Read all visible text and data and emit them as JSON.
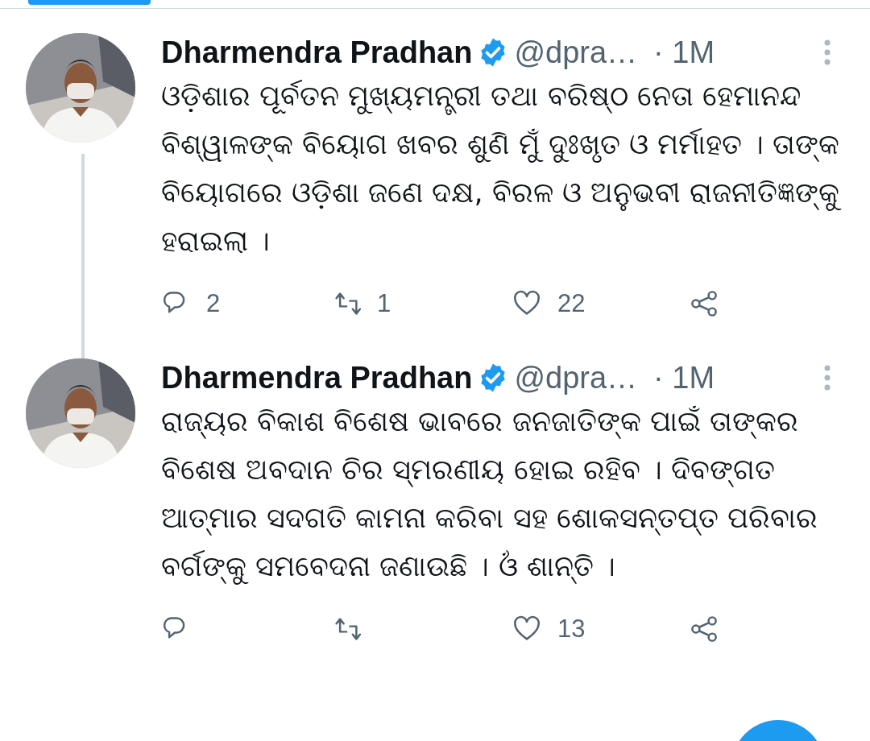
{
  "tab_indicator": {
    "selected": true
  },
  "tweets": [
    {
      "author": "Dharmendra Pradhan",
      "verified": true,
      "handle": "@dpra…",
      "time": "· 1M",
      "text": "ଓଡ଼ିଶାର ପୂର୍ବତନ ମୁଖ୍ୟମନ୍ତ୍ରୀ ତଥା ବରିଷ୍ଠ ନେତା ହେମାନନ୍ଦ ବିଶ୍ୱାଳଙ୍କ ବିୟୋଗ ଖବର ଶୁଣି ମୁଁ ଦୁଃଖୃତ ଓ ମର୍ମାହତ । ତାଙ୍କ ବିୟୋଗରେ ଓଡ଼ିଶା ଜଣେ ଦକ୍ଷ, ବିରଳ ଓ ଅନୁଭବୀ ରାଜନୀତିଜ୍ଞଙ୍କୁ ହରାଇଲା ।",
      "thread_line": true,
      "replies": "2",
      "retweets": "1",
      "likes": "22"
    },
    {
      "author": "Dharmendra Pradhan",
      "verified": true,
      "handle": "@dpra…",
      "time": "· 1M",
      "text": "ରାଜ୍ୟର ବିକାଶ ବିଶେଷ ଭାବରେ ଜନଜାତିଙ୍କ ପାଇଁ ତାଙ୍କର ବିଶେଷ ଅବଦାନ ଚିର ସ୍ମରଣୀୟ ହୋଇ ରହିବ । ଦିବଙ୍ଗତ ଆତ୍ମାର ସଦଗତି କାମନା କରିବା ସହ ଶୋକସନ୍ତପ୍ତ ପରିବାର ବର୍ଗଙ୍କୁ ସମବେଦନା ଜଣାଉଛି । ଓଁ ଶାନ୍ତି ।",
      "thread_line": false,
      "likes": "13"
    }
  ]
}
